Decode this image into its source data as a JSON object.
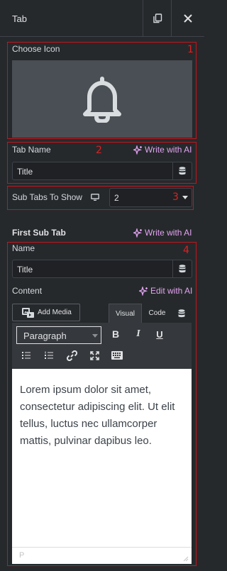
{
  "panel": {
    "title": "Tab"
  },
  "header": {
    "copy_icon": "copy-icon",
    "close_icon": "close-icon"
  },
  "annotations": {
    "n1": "1",
    "n2": "2",
    "n3": "3",
    "n4": "4"
  },
  "choose_icon": {
    "label": "Choose Icon",
    "icon": "bell-icon"
  },
  "tab_name": {
    "label": "Tab Name",
    "ai_label": "Write with AI",
    "value": "Title"
  },
  "sub_tabs": {
    "label": "Sub Tabs To Show",
    "value": "2",
    "device_icon": "desktop-icon"
  },
  "first_sub_tab": {
    "title": "First Sub Tab",
    "ai_label": "Write with AI",
    "name_label": "Name",
    "name_value": "Title",
    "content_label": "Content",
    "edit_ai_label": "Edit with AI",
    "add_media": "Add Media",
    "tabs": {
      "visual": "Visual",
      "code": "Code"
    },
    "format_select": "Paragraph",
    "toolbar": {
      "bold": "B",
      "italic": "I",
      "underline": "U"
    },
    "content_text": "Lorem ipsum dolor sit amet, consectetur adipiscing elit. Ut elit tellus, luctus nec ullamcorper mattis, pulvinar dapibus leo.",
    "status_path": "P"
  },
  "colors": {
    "background": "#26292c",
    "annotation": "#c4151c",
    "ai_accent": "#e1a3f0"
  }
}
